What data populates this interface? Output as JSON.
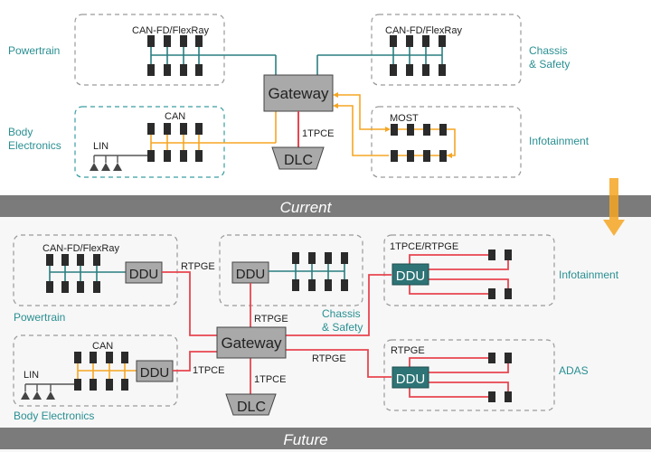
{
  "colors": {
    "teal": "#2a7f80",
    "teal_text": "#2a8f92",
    "orange": "#f5a623",
    "red": "#e8454f",
    "band": "#7b7b7b",
    "node": "#2b2b2b",
    "box_gray": "#a9a9a9",
    "ddu_teal": "#2e7476",
    "dashed_gray": "#9a9a9a",
    "dashed_teal": "#3a9ea0"
  },
  "current": {
    "band_label": "Current",
    "domains": {
      "powertrain": "Powertrain",
      "body_electronics_line1": "Body",
      "body_electronics_line2": "Electronics",
      "chassis_line1": "Chassis",
      "chassis_line2": "& Safety",
      "infotainment": "Infotainment"
    },
    "buses": {
      "powertrain_bus": "CAN-FD/FlexRay",
      "chassis_bus": "CAN-FD/FlexRay",
      "body_can": "CAN",
      "body_lin": "LIN",
      "infotainment_bus": "MOST"
    },
    "gateway": "Gateway",
    "dlc": "DLC",
    "dlc_link": "1TPCE"
  },
  "future": {
    "band_label": "Future",
    "domains": {
      "powertrain": "Powertrain",
      "body_electronics": "Body Electronics",
      "chassis_line1": "Chassis",
      "chassis_line2": "& Safety",
      "infotainment": "Infotainment",
      "adas": "ADAS"
    },
    "buses": {
      "powertrain_bus": "CAN-FD/FlexRay",
      "body_can": "CAN",
      "body_lin": "LIN",
      "infotainment_bus": "1TPCE/RTPGE",
      "adas_bus": "RTPGE"
    },
    "ddu": "DDU",
    "gateway": "Gateway",
    "dlc": "DLC",
    "links": {
      "powertrain_link": "RTPGE",
      "chassis_link": "RTPGE",
      "body_link": "1TPCE",
      "dlc_link": "1TPCE",
      "adas_link": "RTPGE"
    }
  },
  "transition_arrow": "down-arrow-icon"
}
